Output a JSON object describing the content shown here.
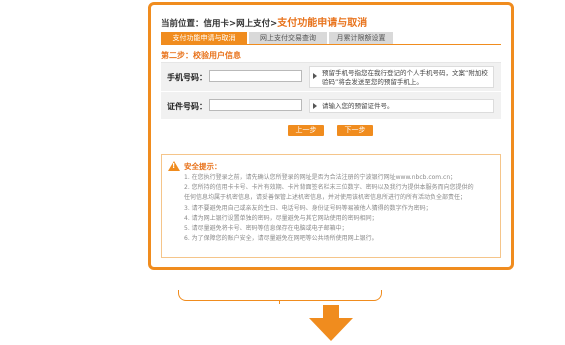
{
  "breadcrumb": {
    "prefix": "当前位置：信用卡>网上支付>",
    "current": "支付功能申请与取消"
  },
  "tabs": [
    {
      "label": "支付功能申请与取消",
      "active": true
    },
    {
      "label": "网上支付交易查询",
      "active": false
    },
    {
      "label": "月累计限额设置",
      "active": false
    }
  ],
  "step": {
    "title": "第二步：校验用户信息"
  },
  "form": {
    "phone": {
      "label": "手机号码：",
      "value": "",
      "hint": "预留手机号指您在我行登记的个人手机号码，文案“附加校验码”将会发送至您的预留手机上。"
    },
    "id": {
      "label": "证件号码：",
      "value": "",
      "hint": "请输入您的预留证件号。"
    }
  },
  "buttons": {
    "prev": "上一步",
    "next": "下一步"
  },
  "security": {
    "title": "安全提示：",
    "items": [
      "1. 在您执行登录之前，请先确认您所登录的网址是否为合法注册的宁波银行网址www.nbcb.com.cn；",
      "2. 您所持的信用卡卡号、卡片有效期、卡片背面签名栏末三位数字、密码以及我行为提供本服务而向您提供的",
      "   任何信息均属于机密信息，请妥善保管上述机密信息，并对使用该机密信息所进行的所有活动负全部责任；",
      "3. 请不要避免用自己或亲友的生日、电话号码、身份证号码等易被他人猜得的数字作为密码；",
      "4. 请为网上银行设置单独的密码，尽量避免与其它网站使用的密码相同；",
      "5. 请尽量避免将卡号、密码等信息保存在电脑或电子邮箱中；",
      "6. 为了保障您的账户安全，请尽量避免在网吧等公共场所使用网上银行。"
    ]
  },
  "colors": {
    "accent": "#f08c1e",
    "accent_text": "#e8731c"
  }
}
